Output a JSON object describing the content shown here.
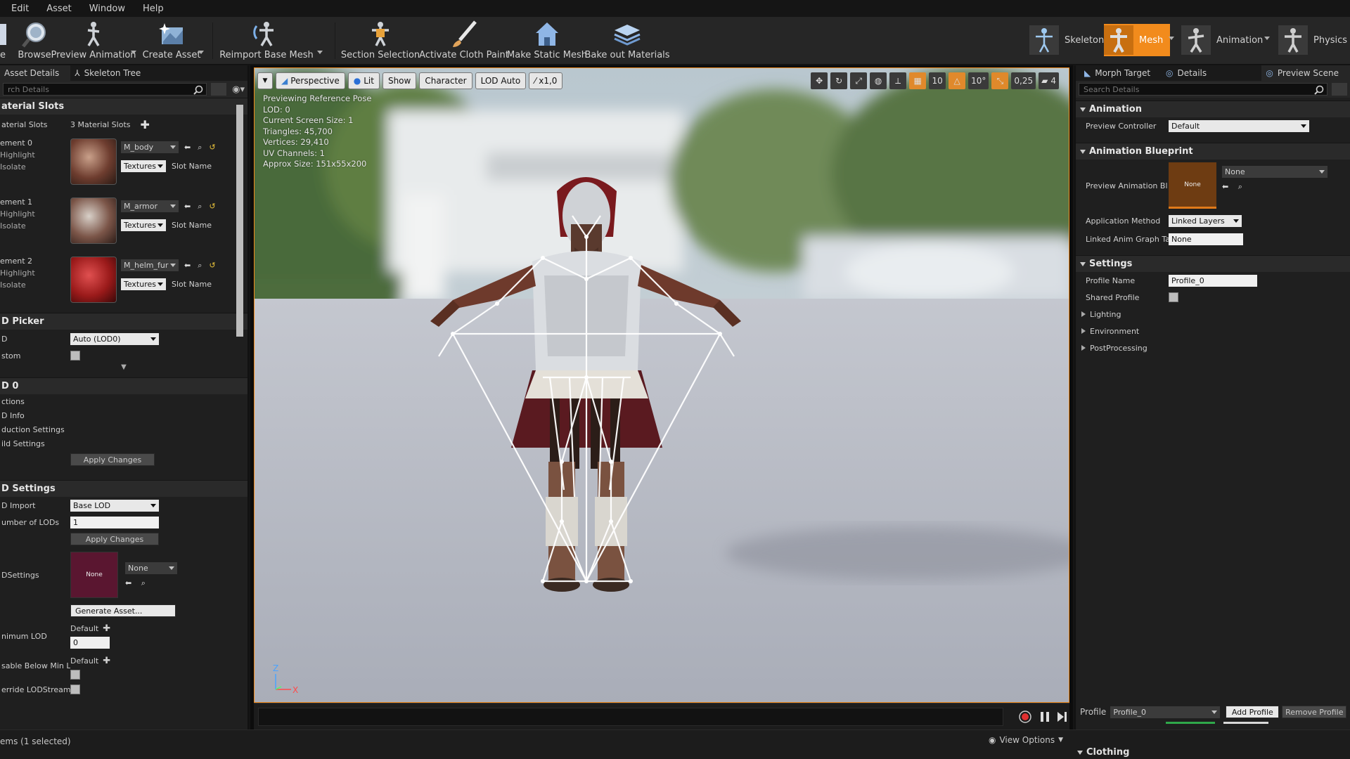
{
  "menu": [
    "Edit",
    "Asset",
    "Window",
    "Help"
  ],
  "toolbar": {
    "save": "e",
    "browse": "Browse",
    "preview_animation": "Preview Animation",
    "create_asset": "Create Asset",
    "reimport": "Reimport Base Mesh",
    "section_selection": "Section Selection",
    "cloth_paint": "Activate Cloth Paint",
    "static_mesh": "Make Static Mesh",
    "bake_materials": "Bake out Materials"
  },
  "modes": {
    "skeleton": "Skeleton",
    "mesh": "Mesh",
    "animation": "Animation",
    "physics": "Physics"
  },
  "left": {
    "tabs": [
      "Asset Details",
      "Skeleton Tree"
    ],
    "search_placeholder": "rch Details",
    "material_slots_header": "aterial Slots",
    "material_slots_label": "aterial Slots",
    "material_slots_count": "3 Material Slots",
    "elements": [
      {
        "name": "ement 0",
        "material": "M_body",
        "highlight": "Highlight",
        "isolate": "Isolate",
        "textures": "Textures",
        "slot": "Slot Name"
      },
      {
        "name": "ement 1",
        "material": "M_armor",
        "highlight": "Highlight",
        "isolate": "Isolate",
        "textures": "Textures",
        "slot": "Slot Name"
      },
      {
        "name": "ement 2",
        "material": "M_helm_fur",
        "highlight": "Highlight",
        "isolate": "Isolate",
        "textures": "Textures",
        "slot": "Slot Name"
      }
    ],
    "lod_picker_header": "D Picker",
    "lod_label": "D",
    "lod_value": "Auto (LOD0)",
    "custom_label": "stom",
    "lod0_header": "D 0",
    "lod0_items": [
      "ctions",
      "D Info",
      "duction Settings",
      "ild Settings"
    ],
    "apply_changes": "Apply Changes",
    "lod_settings_header": "D Settings",
    "lod_import_label": "D Import",
    "lod_import_value": "Base LOD",
    "num_lods_label": "umber of LODs",
    "num_lods_value": "1",
    "apply_changes_2": "Apply Changes",
    "lodsettings_label": "DSettings",
    "lodsettings_thumb": "None",
    "lodsettings_value": "None",
    "generate_asset": "Generate Asset...",
    "min_lod_label": "nimum LOD",
    "min_lod_default": "Default",
    "min_lod_value": "0",
    "disable_below_label": "sable Below Min Lo",
    "disable_default": "Default",
    "override_label": "erride LODStreami"
  },
  "viewport": {
    "buttons": [
      "Perspective",
      "Lit",
      "Show",
      "Character",
      "LOD Auto",
      "x1,0"
    ],
    "stats": [
      "Previewing Reference Pose",
      "LOD: 0",
      "Current Screen Size: 1",
      "Triangles: 45,700",
      "Vertices: 29,410",
      "UV Channels: 1",
      "Approx Size: 151x55x200"
    ],
    "grid_snap": "10",
    "rot_snap": "10°",
    "scale_snap": "0,25",
    "camera_speed": "4",
    "axis_z": "Z",
    "axis_x": "X"
  },
  "right": {
    "tabs": [
      "Morph Target",
      "Details",
      "Preview Scene"
    ],
    "search_placeholder": "Search Details",
    "animation_header": "Animation",
    "preview_controller_label": "Preview Controller",
    "preview_controller_value": "Default",
    "anim_bp_header": "Animation Blueprint",
    "preview_anim_bp_label": "Preview Animation Bl",
    "preview_anim_thumb": "None",
    "preview_anim_value": "None",
    "app_method_label": "Application Method",
    "app_method_value": "Linked Layers",
    "linked_graph_label": "Linked Anim Graph Ta",
    "linked_graph_value": "None",
    "settings_header": "Settings",
    "profile_name_label": "Profile Name",
    "profile_name_value": "Profile_0",
    "shared_profile_label": "Shared Profile",
    "sub_groups": [
      "Lighting",
      "Environment",
      "PostProcessing"
    ],
    "profile_label": "Profile",
    "profile_value": "Profile_0",
    "add_profile": "Add Profile",
    "remove_profile": "Remove Profile",
    "clothing": "Clothing"
  },
  "status": {
    "items_selected": "ems (1 selected)",
    "view_options": "View Options"
  },
  "colors": {
    "accent": "#f28b1c",
    "panel": "#1f1f1f",
    "toolbar": "#262626"
  }
}
